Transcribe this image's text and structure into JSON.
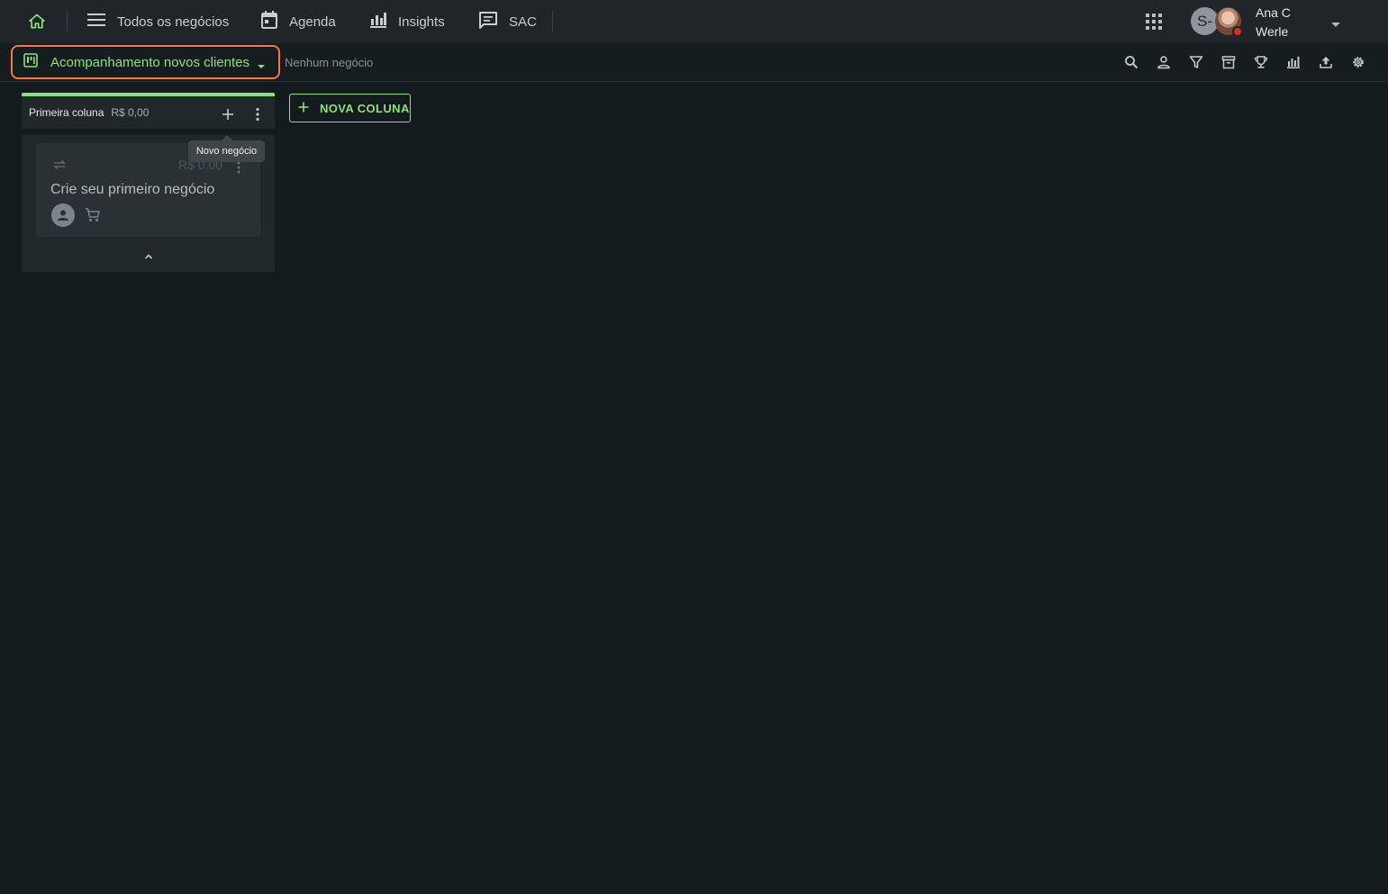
{
  "nav": {
    "home_icon": "home-icon",
    "items": [
      {
        "label": "Todos os negócios",
        "icon": "menu-icon"
      },
      {
        "label": "Agenda",
        "icon": "calendar-icon"
      },
      {
        "label": "Insights",
        "icon": "bar-chart-icon"
      },
      {
        "label": "SAC",
        "icon": "chat-icon"
      }
    ],
    "apps_icon": "apps-grid-icon"
  },
  "user": {
    "initials": "S-",
    "name_line1": "Ana C",
    "name_line2": "Werle",
    "status_color": "#e32a22"
  },
  "pipeline": {
    "name": "Acompanhamento novos clientes",
    "deal_count": "Nenhum negócio",
    "accent": "#8fe07a",
    "focus_color": "#f07a43"
  },
  "toolbar_icons": [
    "search-icon",
    "person-icon",
    "filter-icon",
    "archive-icon",
    "trophy-icon",
    "chart-icon",
    "upload-icon",
    "settings-icon"
  ],
  "column": {
    "title": "Primeira coluna",
    "value": "R$ 0,00",
    "add_tooltip": "Novo negócio",
    "card": {
      "value": "R$ 0,00",
      "title": "Crie seu primeiro negócio"
    }
  },
  "new_column_label": "NOVA COLUNA"
}
